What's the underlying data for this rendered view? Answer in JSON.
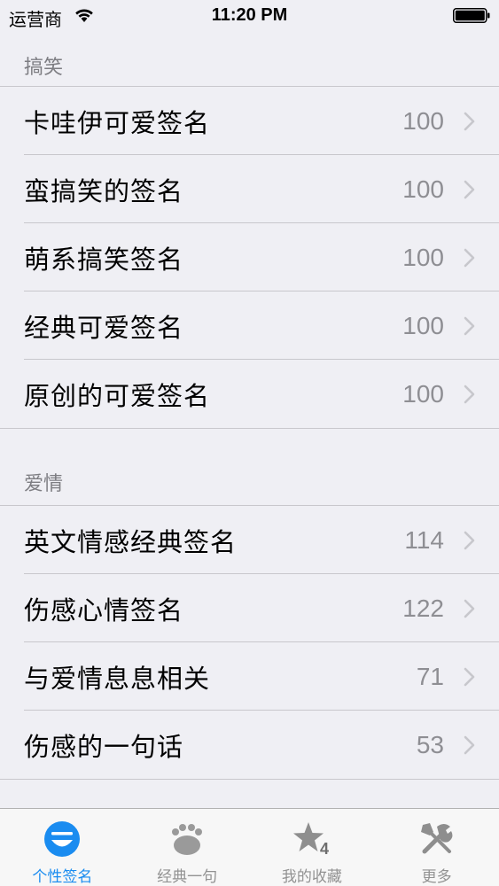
{
  "status_bar": {
    "carrier": "运营商",
    "time": "11:20 PM",
    "wifi_icon": "wifi-icon",
    "battery_icon": "battery-icon"
  },
  "sections": [
    {
      "title": "搞笑",
      "rows": [
        {
          "label": "卡哇伊可爱签名",
          "count": "100"
        },
        {
          "label": "蛮搞笑的签名",
          "count": "100"
        },
        {
          "label": "萌系搞笑签名",
          "count": "100"
        },
        {
          "label": "经典可爱签名",
          "count": "100"
        },
        {
          "label": "原创的可爱签名",
          "count": "100"
        }
      ]
    },
    {
      "title": "爱情",
      "rows": [
        {
          "label": "英文情感经典签名",
          "count": "114"
        },
        {
          "label": "伤感心情签名",
          "count": "122"
        },
        {
          "label": "与爱情息息相关",
          "count": "71"
        },
        {
          "label": "伤感的一句话",
          "count": "53"
        }
      ]
    }
  ],
  "tab_bar": {
    "tabs": [
      {
        "label": "个性签名",
        "icon": "smiley-icon",
        "active": true
      },
      {
        "label": "经典一句",
        "icon": "paw-icon",
        "active": false
      },
      {
        "label": "我的收藏",
        "icon": "star-icon",
        "active": false
      },
      {
        "label": "更多",
        "icon": "tools-icon",
        "active": false
      }
    ],
    "badge_text": "4"
  },
  "colors": {
    "background": "#efeff4",
    "separator": "#c8c7cc",
    "active_tab": "#1a8cf0",
    "inactive_tab": "#929292",
    "section_header": "#7d7d82",
    "count_text": "#8e8e93"
  }
}
